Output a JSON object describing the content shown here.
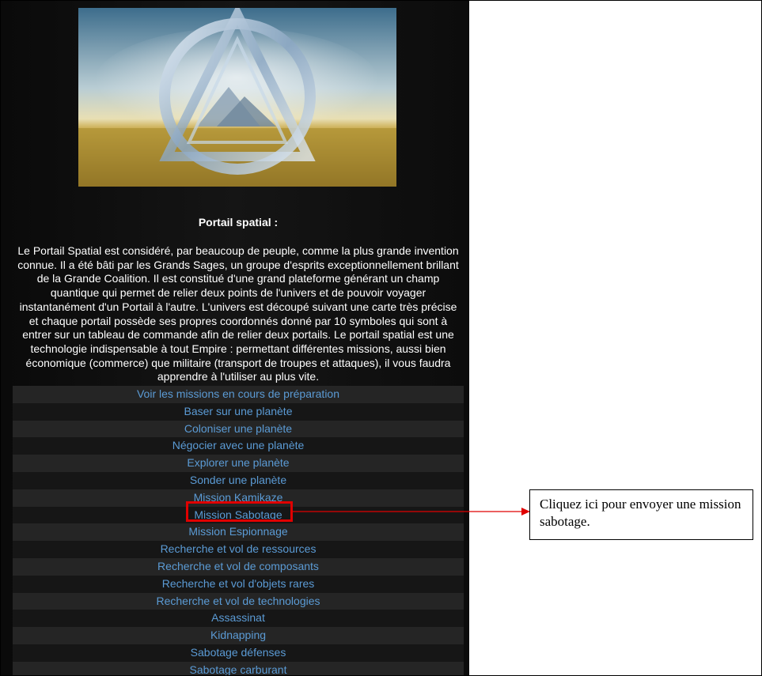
{
  "heading": "Portail spatial :",
  "description": "Le Portail Spatial est considéré, par beaucoup de peuple, comme la plus grande invention connue. Il a été bâti par les Grands Sages, un groupe d'esprits exceptionnellement brillant de la Grande Coalition. Il est constitué d'une grand plateforme générant un champ quantique qui permet de relier deux points de l'univers et de pouvoir voyager instantanément d'un Portail à l'autre. L'univers est découpé suivant une carte très précise et chaque portail possède ses propres coordonnés donné par 10 symboles qui sont à entrer sur un tableau de commande afin de relier deux portails. Le portail spatial est une technologie indispensable à tout Empire : permettant différentes missions, aussi bien économique (commerce) que militaire (transport de troupes et attaques), il vous faudra apprendre à l'utiliser au plus vite.",
  "menu": [
    "Voir les missions en cours de préparation",
    "Baser sur une planète",
    "Coloniser une planète",
    "Négocier avec une planète",
    "Explorer une planète",
    "Sonder une planète",
    "Mission Kamikaze",
    "Mission Sabotage",
    "Mission Espionnage",
    "Recherche et vol de ressources",
    "Recherche et vol de composants",
    "Recherche et vol d'objets rares",
    "Recherche et vol de technologies",
    "Assassinat",
    "Kidnapping",
    "Sabotage défenses",
    "Sabotage carburant"
  ],
  "highlighted_item": "Mission Sabotage",
  "callout": "Cliquez ici pour envoyer une mission sabotage.",
  "colors": {
    "link": "#5b9bd5",
    "highlight": "#e00000",
    "panel_bg": "#111111"
  }
}
